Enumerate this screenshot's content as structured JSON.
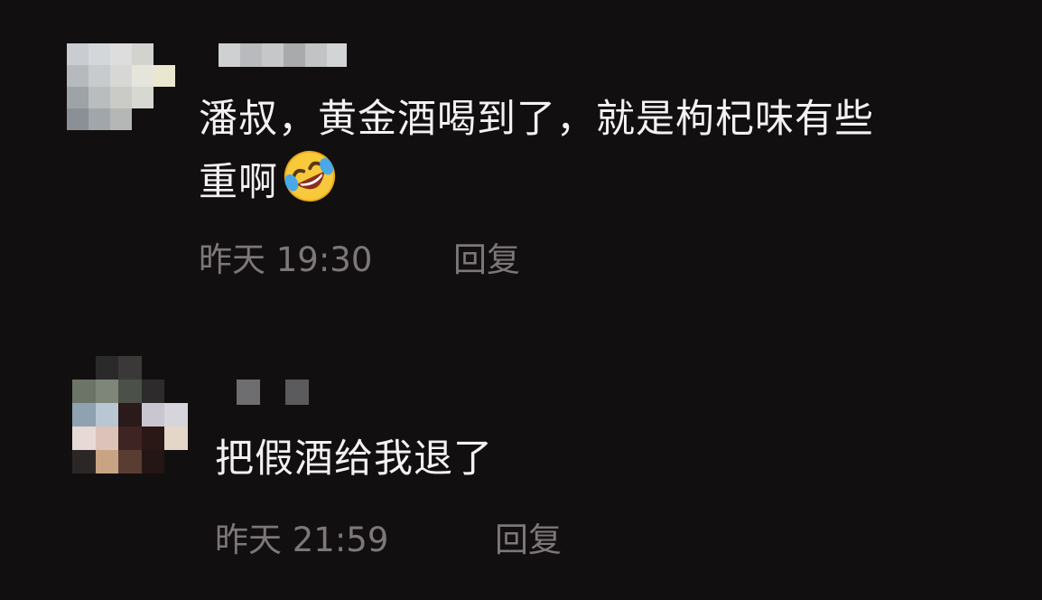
{
  "comments": [
    {
      "text_line1": "潘叔，黄金酒喝到了，就是枸杞味有些",
      "text_line2": "重啊",
      "emoji": "rolling-on-floor-laughing-emoji",
      "time": "昨天 19:30",
      "reply_label": "回复"
    },
    {
      "text_line1": "把假酒给我退了",
      "time": "昨天 21:59",
      "reply_label": "回复"
    }
  ],
  "colors": {
    "background": "#120f10",
    "text": "#f4f1f2",
    "meta": "#7d7779"
  }
}
